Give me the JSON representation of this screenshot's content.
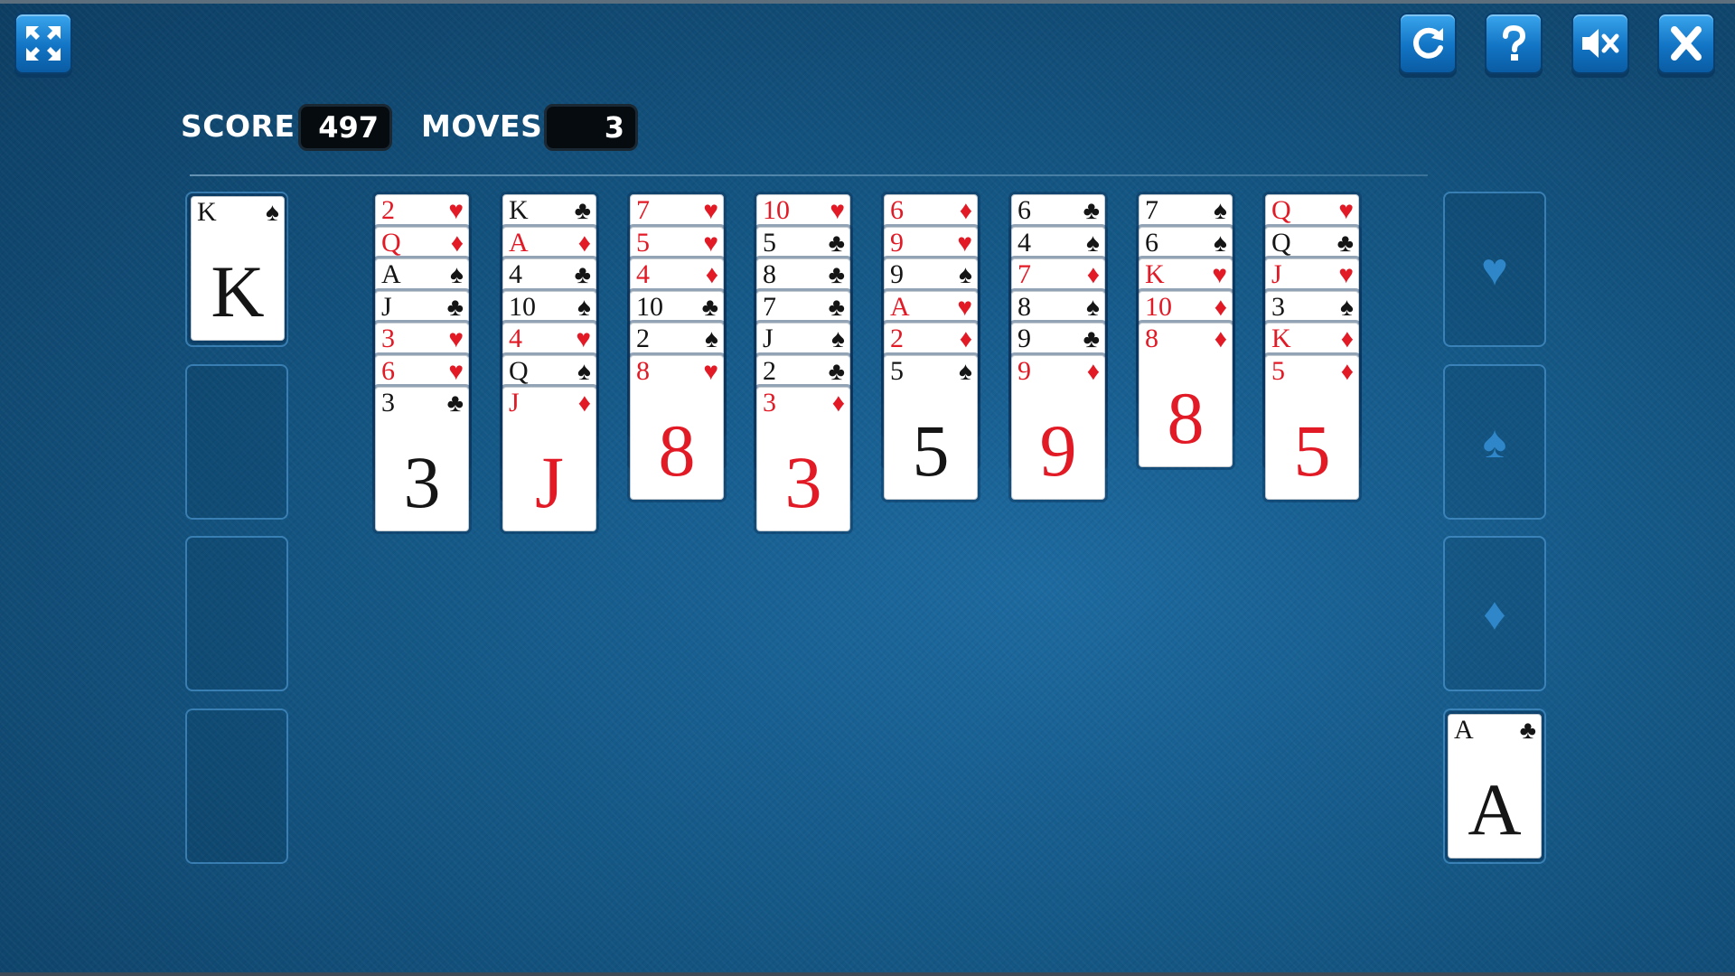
{
  "hud": {
    "score_label": "SCORE",
    "score_value": "497",
    "moves_label": "MOVES",
    "moves_value": "3"
  },
  "buttons": {
    "fullscreen": "fullscreen-icon",
    "restart": "restart-icon",
    "help": "help-icon",
    "sound": "sound-muted-icon",
    "close": "close-icon"
  },
  "colors": {
    "red": "#e11a26",
    "black": "#151515",
    "button": "#1274c4",
    "table": "#145785"
  },
  "free_cells": [
    {
      "rank": "K",
      "suit": "♠",
      "color": "black"
    },
    null,
    null,
    null
  ],
  "foundations": [
    {
      "placeholder": "♥",
      "card": null
    },
    {
      "placeholder": "♠",
      "card": null
    },
    {
      "placeholder": "♦",
      "card": null
    },
    {
      "placeholder": "♣",
      "card": {
        "rank": "A",
        "suit": "♣",
        "color": "black"
      }
    }
  ],
  "tableau": [
    [
      {
        "rank": "2",
        "suit": "♥",
        "color": "red"
      },
      {
        "rank": "Q",
        "suit": "♦",
        "color": "red"
      },
      {
        "rank": "A",
        "suit": "♠",
        "color": "black"
      },
      {
        "rank": "J",
        "suit": "♣",
        "color": "black"
      },
      {
        "rank": "3",
        "suit": "♥",
        "color": "red"
      },
      {
        "rank": "6",
        "suit": "♥",
        "color": "red"
      },
      {
        "rank": "3",
        "suit": "♣",
        "color": "black"
      }
    ],
    [
      {
        "rank": "K",
        "suit": "♣",
        "color": "black"
      },
      {
        "rank": "A",
        "suit": "♦",
        "color": "red"
      },
      {
        "rank": "4",
        "suit": "♣",
        "color": "black"
      },
      {
        "rank": "10",
        "suit": "♠",
        "color": "black"
      },
      {
        "rank": "4",
        "suit": "♥",
        "color": "red"
      },
      {
        "rank": "Q",
        "suit": "♠",
        "color": "black"
      },
      {
        "rank": "J",
        "suit": "♦",
        "color": "red"
      }
    ],
    [
      {
        "rank": "7",
        "suit": "♥",
        "color": "red"
      },
      {
        "rank": "5",
        "suit": "♥",
        "color": "red"
      },
      {
        "rank": "4",
        "suit": "♦",
        "color": "red"
      },
      {
        "rank": "10",
        "suit": "♣",
        "color": "black"
      },
      {
        "rank": "2",
        "suit": "♠",
        "color": "black"
      },
      {
        "rank": "8",
        "suit": "♥",
        "color": "red"
      }
    ],
    [
      {
        "rank": "10",
        "suit": "♥",
        "color": "red"
      },
      {
        "rank": "5",
        "suit": "♣",
        "color": "black"
      },
      {
        "rank": "8",
        "suit": "♣",
        "color": "black"
      },
      {
        "rank": "7",
        "suit": "♣",
        "color": "black"
      },
      {
        "rank": "J",
        "suit": "♠",
        "color": "black"
      },
      {
        "rank": "2",
        "suit": "♣",
        "color": "black"
      },
      {
        "rank": "3",
        "suit": "♦",
        "color": "red"
      }
    ],
    [
      {
        "rank": "6",
        "suit": "♦",
        "color": "red"
      },
      {
        "rank": "9",
        "suit": "♥",
        "color": "red"
      },
      {
        "rank": "9",
        "suit": "♠",
        "color": "black"
      },
      {
        "rank": "A",
        "suit": "♥",
        "color": "red"
      },
      {
        "rank": "2",
        "suit": "♦",
        "color": "red"
      },
      {
        "rank": "5",
        "suit": "♠",
        "color": "black"
      }
    ],
    [
      {
        "rank": "6",
        "suit": "♣",
        "color": "black"
      },
      {
        "rank": "4",
        "suit": "♠",
        "color": "black"
      },
      {
        "rank": "7",
        "suit": "♦",
        "color": "red"
      },
      {
        "rank": "8",
        "suit": "♠",
        "color": "black"
      },
      {
        "rank": "9",
        "suit": "♣",
        "color": "black"
      },
      {
        "rank": "9",
        "suit": "♦",
        "color": "red"
      }
    ],
    [
      {
        "rank": "7",
        "suit": "♠",
        "color": "black"
      },
      {
        "rank": "6",
        "suit": "♠",
        "color": "black"
      },
      {
        "rank": "K",
        "suit": "♥",
        "color": "red"
      },
      {
        "rank": "10",
        "suit": "♦",
        "color": "red"
      },
      {
        "rank": "8",
        "suit": "♦",
        "color": "red"
      }
    ],
    [
      {
        "rank": "Q",
        "suit": "♥",
        "color": "red"
      },
      {
        "rank": "Q",
        "suit": "♣",
        "color": "black"
      },
      {
        "rank": "J",
        "suit": "♥",
        "color": "red"
      },
      {
        "rank": "3",
        "suit": "♠",
        "color": "black"
      },
      {
        "rank": "K",
        "suit": "♦",
        "color": "red"
      },
      {
        "rank": "5",
        "suit": "♦",
        "color": "red"
      }
    ]
  ]
}
